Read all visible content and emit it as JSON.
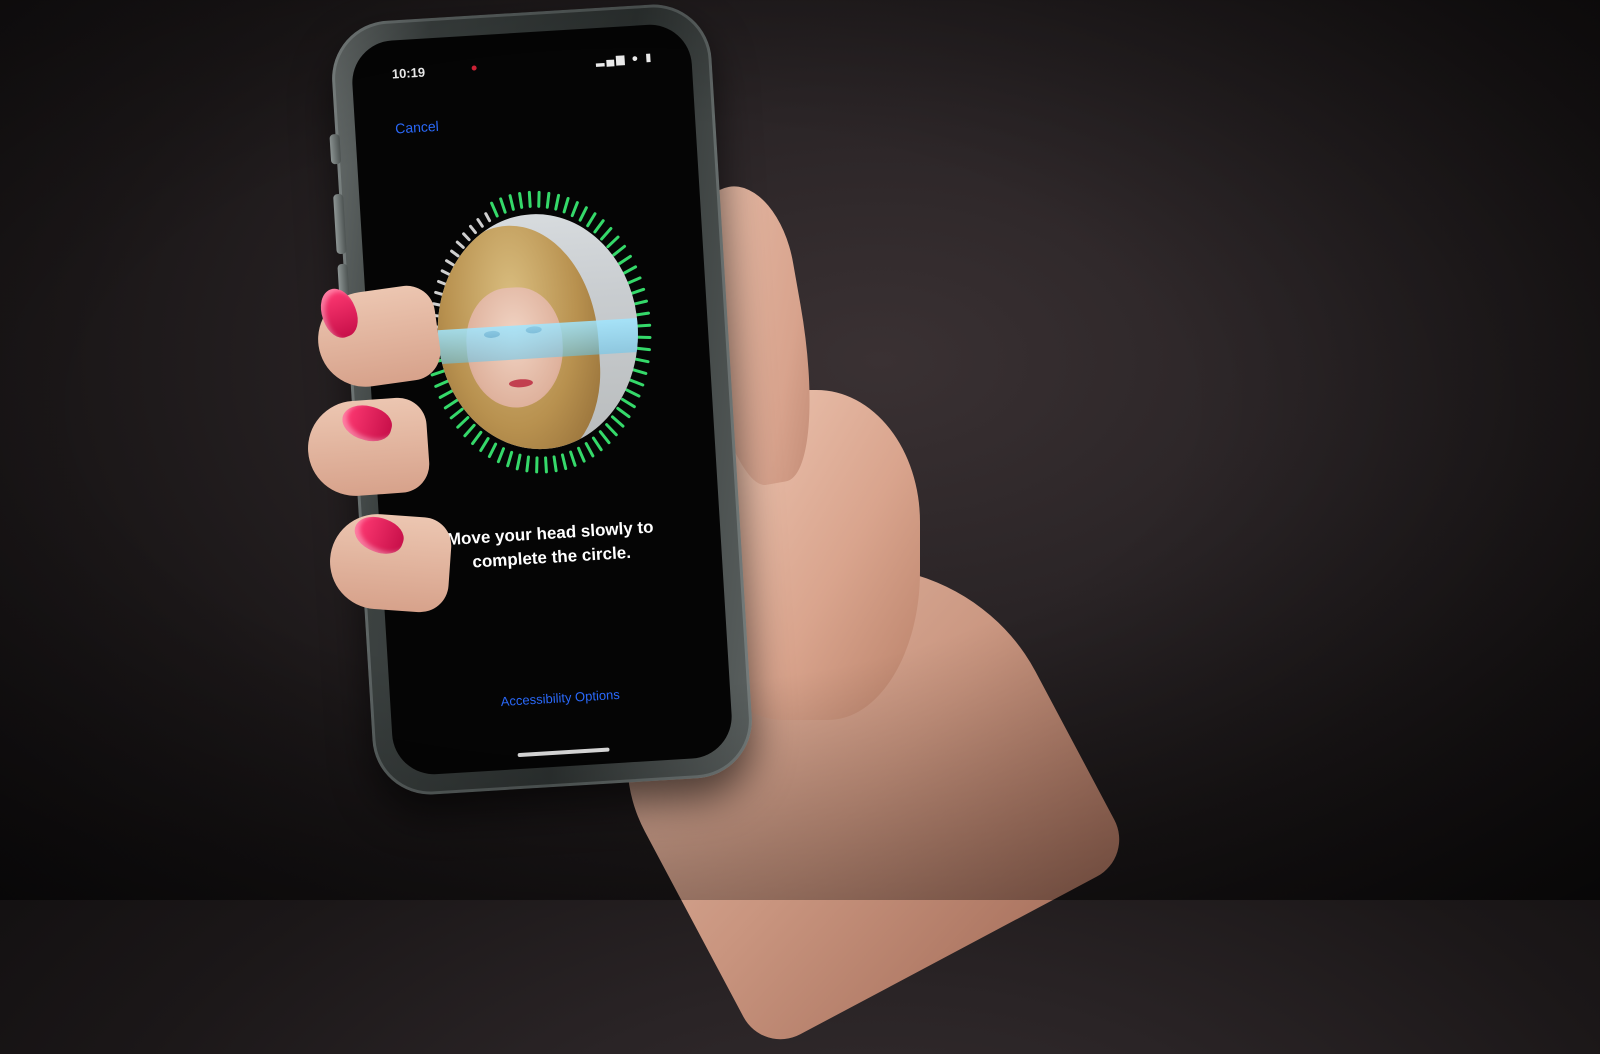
{
  "status_bar": {
    "time": "10:19",
    "signal_icon": "signal-bars-icon",
    "wifi_icon": "wifi-icon",
    "battery_icon": "battery-icon"
  },
  "nav": {
    "cancel_label": "Cancel"
  },
  "face_scan": {
    "instruction_line1": "Move your head slowly to",
    "instruction_line2": "complete the circle."
  },
  "footer": {
    "accessibility_label": "Accessibility Options"
  },
  "colors": {
    "accent_blue": "#2b6bff",
    "progress_green": "#35d96a",
    "pending_tick": "#cfcfcf",
    "nail_polish": "#e01a5c"
  }
}
